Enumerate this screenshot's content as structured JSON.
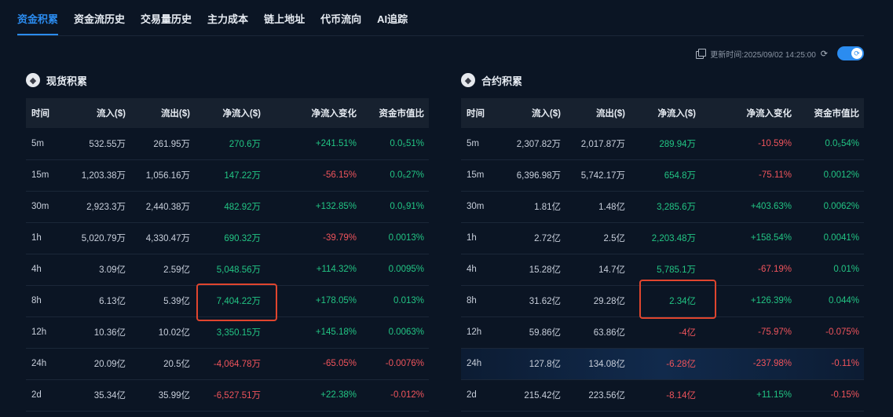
{
  "tabs": [
    {
      "label": "资金积累",
      "active": true
    },
    {
      "label": "资金流历史",
      "active": false
    },
    {
      "label": "交易量历史",
      "active": false
    },
    {
      "label": "主力成本",
      "active": false
    },
    {
      "label": "链上地址",
      "active": false
    },
    {
      "label": "代币流向",
      "active": false
    },
    {
      "label": "AI追踪",
      "active": false
    }
  ],
  "update": {
    "text": "更新时间:2025/09/02 14:25:00"
  },
  "columns": [
    "时间",
    "流入($)",
    "流出($)",
    "净流入($)",
    "净流入变化",
    "资金市值比"
  ],
  "spot": {
    "title": "现货积累",
    "rows": [
      {
        "time": "5m",
        "inflow": "532.55万",
        "outflow": "261.95万",
        "net": "270.6万",
        "change": "+241.51%",
        "ratio": "0.0₅51%"
      },
      {
        "time": "15m",
        "inflow": "1,203.38万",
        "outflow": "1,056.16万",
        "net": "147.22万",
        "change": "-56.15%",
        "ratio": "0.0₅27%"
      },
      {
        "time": "30m",
        "inflow": "2,923.3万",
        "outflow": "2,440.38万",
        "net": "482.92万",
        "change": "+132.85%",
        "ratio": "0.0₅91%"
      },
      {
        "time": "1h",
        "inflow": "5,020.79万",
        "outflow": "4,330.47万",
        "net": "690.32万",
        "change": "-39.79%",
        "ratio": "0.0013%"
      },
      {
        "time": "4h",
        "inflow": "3.09亿",
        "outflow": "2.59亿",
        "net": "5,048.56万",
        "change": "+114.32%",
        "ratio": "0.0095%"
      },
      {
        "time": "8h",
        "inflow": "6.13亿",
        "outflow": "5.39亿",
        "net": "7,404.22万",
        "change": "+178.05%",
        "ratio": "0.013%"
      },
      {
        "time": "12h",
        "inflow": "10.36亿",
        "outflow": "10.02亿",
        "net": "3,350.15万",
        "change": "+145.18%",
        "ratio": "0.0063%"
      },
      {
        "time": "24h",
        "inflow": "20.09亿",
        "outflow": "20.5亿",
        "net": "-4,064.78万",
        "change": "-65.05%",
        "ratio": "-0.0076%"
      },
      {
        "time": "2d",
        "inflow": "35.34亿",
        "outflow": "35.99亿",
        "net": "-6,527.51万",
        "change": "+22.38%",
        "ratio": "-0.012%"
      }
    ]
  },
  "futures": {
    "title": "合约积累",
    "rows": [
      {
        "time": "5m",
        "inflow": "2,307.82万",
        "outflow": "2,017.87万",
        "net": "289.94万",
        "change": "-10.59%",
        "ratio": "0.0₅54%"
      },
      {
        "time": "15m",
        "inflow": "6,396.98万",
        "outflow": "5,742.17万",
        "net": "654.8万",
        "change": "-75.11%",
        "ratio": "0.0012%"
      },
      {
        "time": "30m",
        "inflow": "1.81亿",
        "outflow": "1.48亿",
        "net": "3,285.6万",
        "change": "+403.63%",
        "ratio": "0.0062%"
      },
      {
        "time": "1h",
        "inflow": "2.72亿",
        "outflow": "2.5亿",
        "net": "2,203.48万",
        "change": "+158.54%",
        "ratio": "0.0041%"
      },
      {
        "time": "4h",
        "inflow": "15.28亿",
        "outflow": "14.7亿",
        "net": "5,785.1万",
        "change": "-67.19%",
        "ratio": "0.01%"
      },
      {
        "time": "8h",
        "inflow": "31.62亿",
        "outflow": "29.28亿",
        "net": "2.34亿",
        "change": "+126.39%",
        "ratio": "0.044%"
      },
      {
        "time": "12h",
        "inflow": "59.86亿",
        "outflow": "63.86亿",
        "net": "-4亿",
        "change": "-75.97%",
        "ratio": "-0.075%"
      },
      {
        "time": "24h",
        "inflow": "127.8亿",
        "outflow": "134.08亿",
        "net": "-6.28亿",
        "change": "-237.98%",
        "ratio": "-0.11%"
      },
      {
        "time": "2d",
        "inflow": "215.42亿",
        "outflow": "223.56亿",
        "net": "-8.14亿",
        "change": "+11.15%",
        "ratio": "-0.15%"
      }
    ]
  },
  "colors": {
    "accent": "#2b8cf0",
    "positive": "#22c584",
    "negative": "#f0545c",
    "annotation": "#e0452e"
  },
  "icons": {
    "coin": "ethereum-icon",
    "copy": "copy-icon",
    "refresh": "refresh-icon"
  }
}
